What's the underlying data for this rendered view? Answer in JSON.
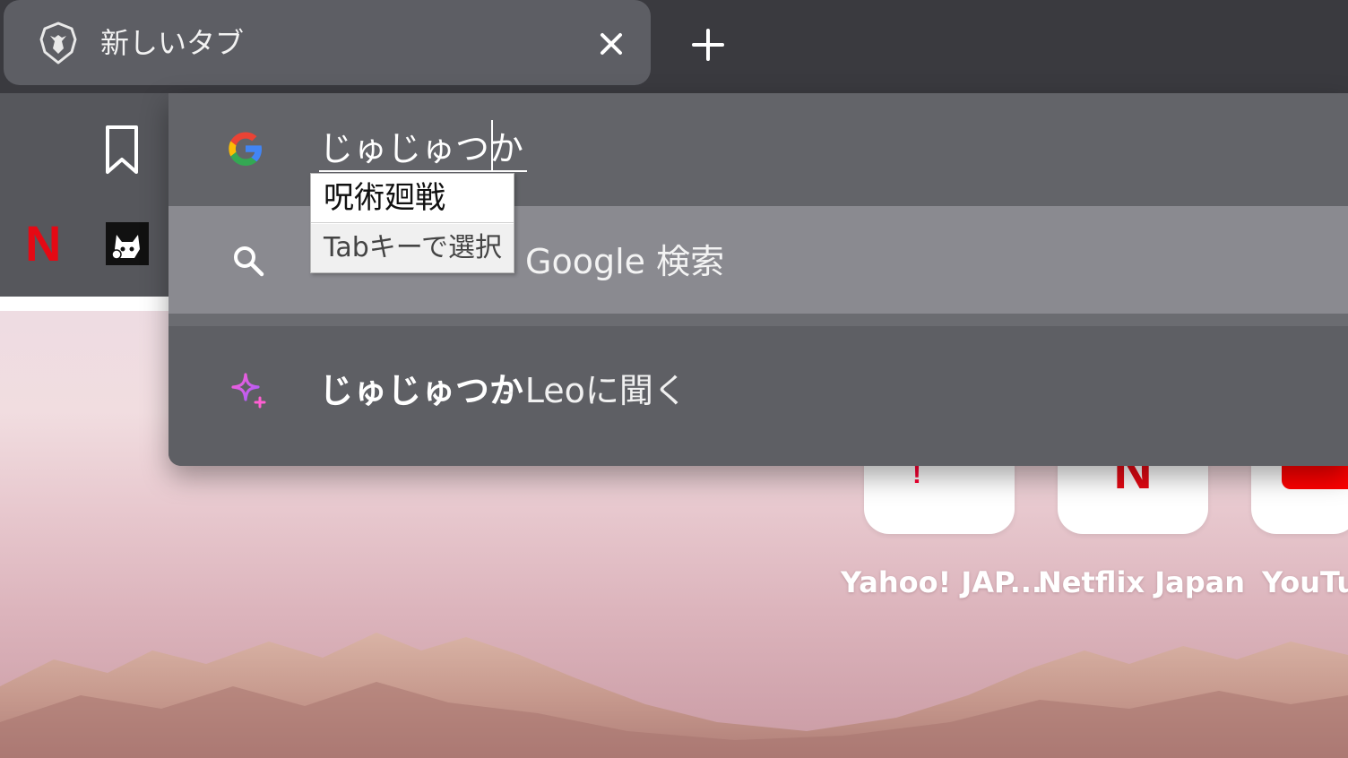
{
  "tab": {
    "title": "新しいタブ",
    "favicon": "brave-lion-icon",
    "close_icon": "close-icon"
  },
  "new_tab_icon": "plus-icon",
  "bookmarks": {
    "items": [
      {
        "icon": "bookmark-icon"
      },
      {
        "icon": "netflix-icon",
        "glyph": "N"
      },
      {
        "icon": "cat-avatar-icon"
      }
    ]
  },
  "omnibox": {
    "input_value": "じゅじゅつか",
    "provider_icon": "google-icon",
    "suggestions": [
      {
        "icon": "search-icon",
        "text": "Google 検索"
      },
      {
        "icon": "leo-sparkle-icon",
        "query": "じゅじゅつか",
        "suffix": " - Leoに聞く"
      }
    ]
  },
  "ime": {
    "candidate": "呪術廻戦",
    "hint": "Tabキーで選択"
  },
  "speed_dial": [
    {
      "label": "Yahoo! JAP...",
      "mark": "!"
    },
    {
      "label": "Netflix Japan",
      "mark": "N"
    },
    {
      "label": "YouTu"
    }
  ],
  "colors": {
    "tabstrip": "#3a3a3f",
    "omnibox": "#5e5f64",
    "selected_row": "#8a8a90",
    "netflix_red": "#e50914",
    "leo_gradient_start": "#ff5fd2",
    "leo_gradient_end": "#a25cff"
  }
}
